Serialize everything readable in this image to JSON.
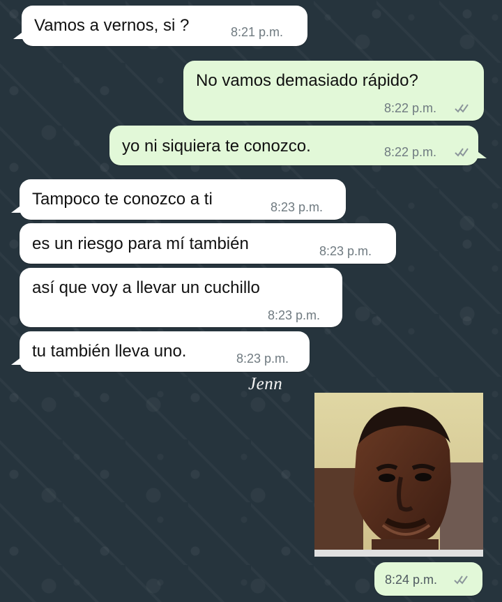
{
  "conversation": {
    "messages": [
      {
        "text": "Vamos a vernos, si ?",
        "time": "8:21 p.m.",
        "direction": "incoming"
      },
      {
        "text": "No vamos demasiado rápido?",
        "time": "8:22 p.m.",
        "direction": "outgoing",
        "status": "read"
      },
      {
        "text": "yo ni siquiera te conozco.",
        "time": "8:22 p.m.",
        "direction": "outgoing",
        "status": "read"
      },
      {
        "text": "Tampoco te conozco a ti",
        "time": "8:23 p.m.",
        "direction": "incoming"
      },
      {
        "text": "es un riesgo para mí también",
        "time": "8:23 p.m.",
        "direction": "incoming"
      },
      {
        "text": "así que voy a llevar un cuchillo",
        "time": "8:23 p.m.",
        "direction": "incoming"
      },
      {
        "text": "tu también lleva uno.",
        "time": "8:23 p.m.",
        "direction": "incoming"
      }
    ],
    "sticker": {
      "description": "pixelated meme face sticker",
      "time": "8:24 p.m.",
      "direction": "outgoing",
      "status": "read"
    }
  },
  "watermark": {
    "signature": "Jenn"
  },
  "colors": {
    "chat_background": "#26343d",
    "incoming_bubble": "#ffffff",
    "outgoing_bubble": "#e2f8d8",
    "timestamp": "#6f7a80",
    "read_ticks": "#8c969b"
  },
  "icons": {
    "read_receipt": "double-check-icon"
  }
}
